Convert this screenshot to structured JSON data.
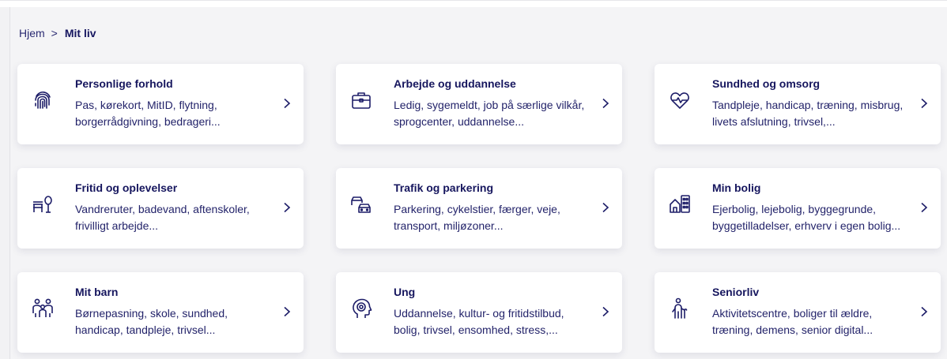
{
  "breadcrumb": {
    "home": "Hjem",
    "separator": ">",
    "current": "Mit liv"
  },
  "colors": {
    "primary_text": "#16165e",
    "icon": "#1d1d68",
    "background": "#f4f4f6",
    "card": "#ffffff"
  },
  "cards": [
    {
      "title": "Personlige forhold",
      "desc": "Pas, kørekort, MitID, flytning, borgerrådgivning, bedrageri...",
      "icon": "fingerprint-icon"
    },
    {
      "title": "Arbejde og uddannelse",
      "desc": "Ledig, sygemeldt, job på særlige vilkår, sprogcenter, uddannelse...",
      "icon": "briefcase-icon"
    },
    {
      "title": "Sundhed og omsorg",
      "desc": "Tandpleje, handicap, træning, misbrug, livets afslutning, trivsel,...",
      "icon": "heart-pulse-icon"
    },
    {
      "title": "Fritid og oplevelser",
      "desc": "Vandreruter, badevand, aftenskoler, frivilligt arbejde...",
      "icon": "bench-tree-icon"
    },
    {
      "title": "Trafik og parkering",
      "desc": "Parkering, cykelstier, færger, veje, transport, miljøzoner...",
      "icon": "cars-icon"
    },
    {
      "title": "Min bolig",
      "desc": "Ejerbolig, lejebolig, byggegrunde, byggetilladelser, erhverv i egen bolig...",
      "icon": "house-building-icon"
    },
    {
      "title": "Mit barn",
      "desc": "Børnepasning, skole, sundhed, handicap, tandpleje, trivsel...",
      "icon": "family-icon"
    },
    {
      "title": "Ung",
      "desc": "Uddannelse, kultur- og fritidstilbud, bolig, trivsel, ensomhed, stress,...",
      "icon": "head-mind-icon"
    },
    {
      "title": "Seniorliv",
      "desc": "Aktivitetscentre, boliger til ældre, træning, demens, senior digital...",
      "icon": "senior-cane-icon"
    }
  ]
}
